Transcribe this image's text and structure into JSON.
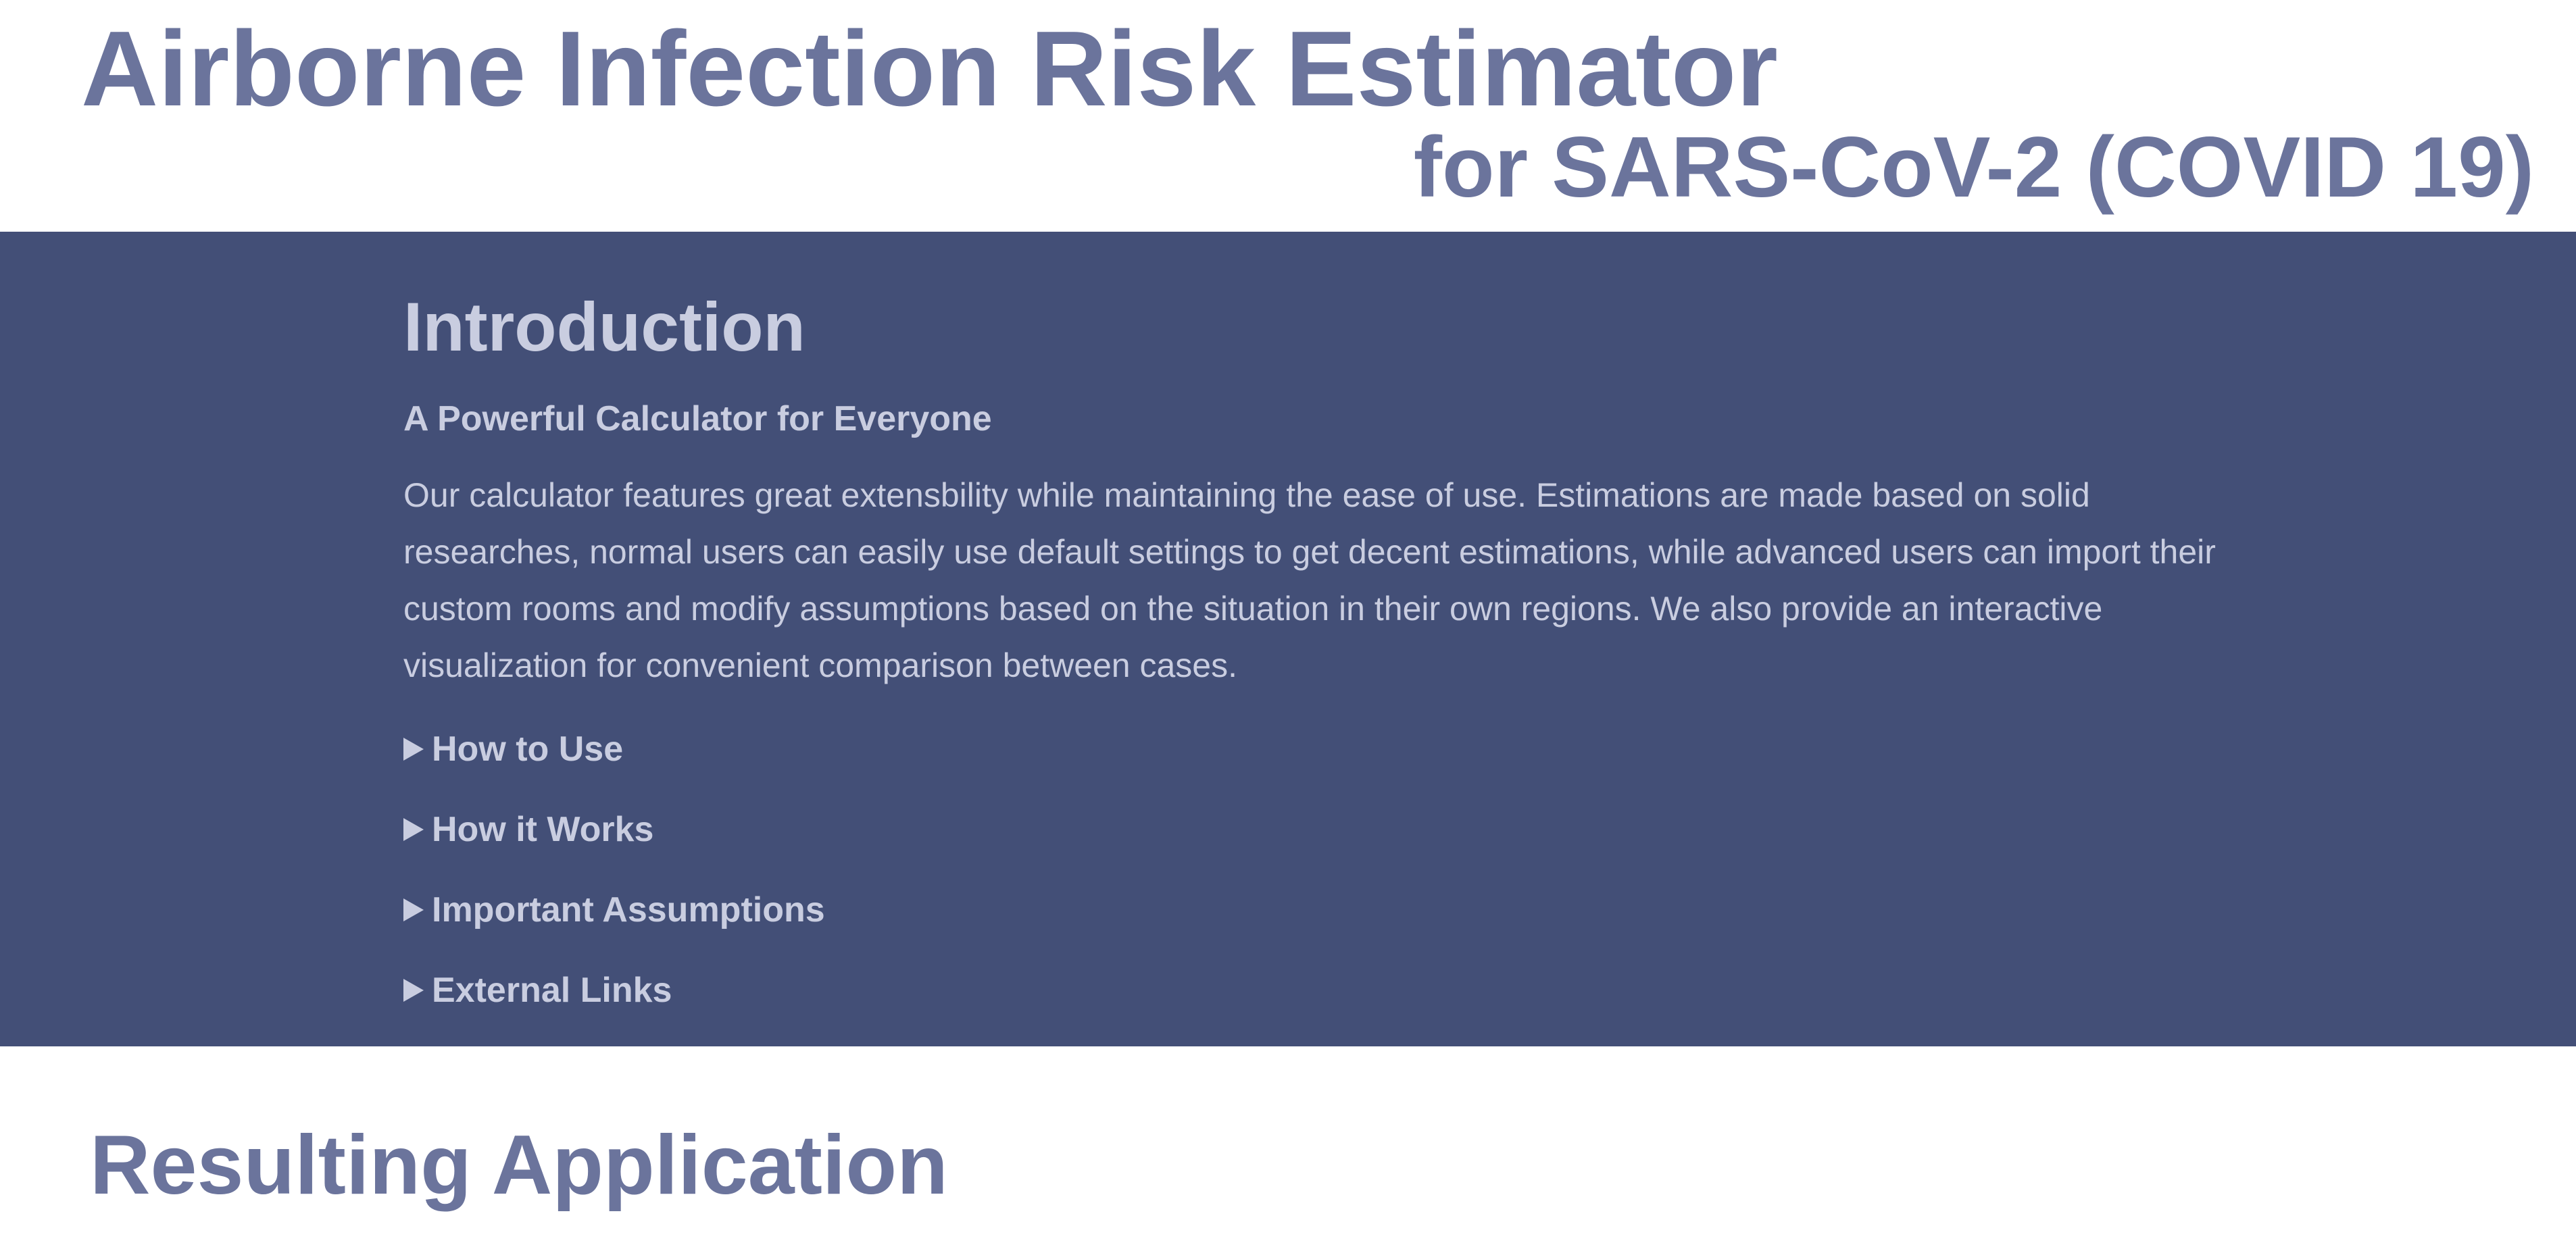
{
  "header": {
    "title": "Airborne Infection Risk Estimator",
    "subtitle": "for SARS-CoV-2 (COVID 19)"
  },
  "intro": {
    "heading": "Introduction",
    "subheading": "A Powerful Calculator for Everyone",
    "body": "Our calculator features great extensbility while maintaining the ease of use. Estimations are made based on solid researches, normal users can easily use default settings to get decent estimations, while advanced users can import their custom rooms and modify assumptions based on the situation in their own regions. We also provide an interactive visualization for convenient comparison between cases.",
    "sections": [
      {
        "label": "How to Use",
        "icon": "triangle-right-icon"
      },
      {
        "label": "How it Works",
        "icon": "triangle-right-icon"
      },
      {
        "label": "Important Assumptions",
        "icon": "triangle-right-icon"
      },
      {
        "label": "External Links",
        "icon": "triangle-right-icon"
      }
    ]
  },
  "results": {
    "heading": "Resulting Application"
  },
  "colors": {
    "title": "#6b749c",
    "intro_background": "#434f77",
    "intro_text": "#c9cde0",
    "page_background": "#ffffff"
  }
}
